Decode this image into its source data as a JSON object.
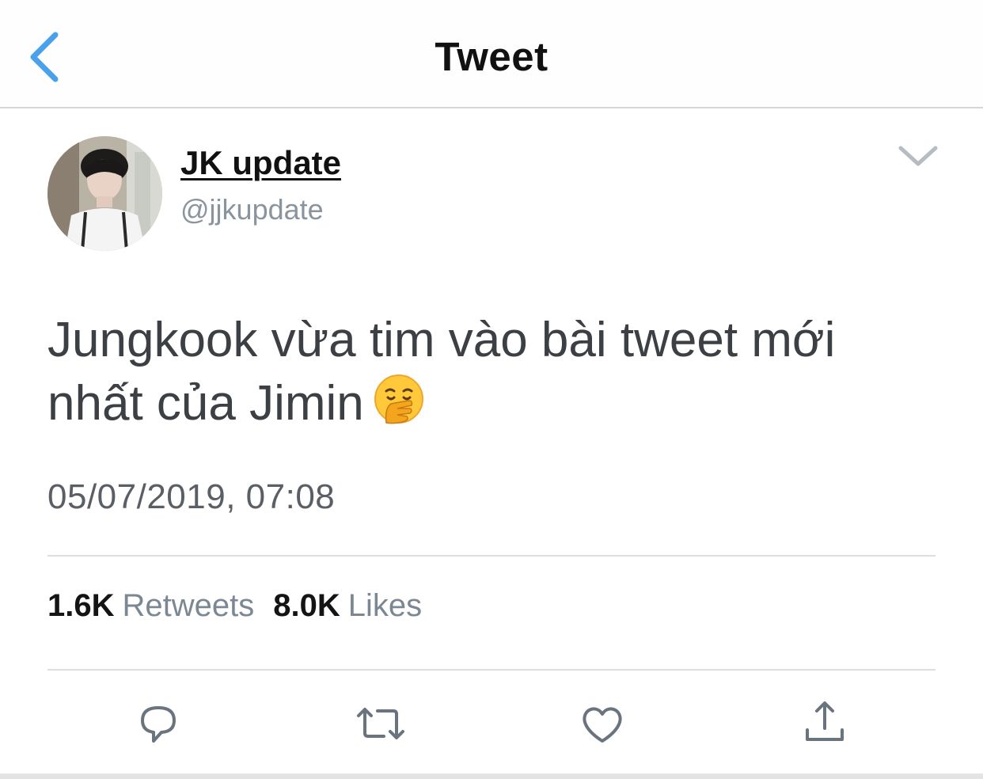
{
  "nav": {
    "title": "Tweet",
    "back_icon": "chevron-left-icon"
  },
  "author": {
    "display_name": "JK update",
    "handle": "@jjkupdate",
    "menu_icon": "chevron-down-icon"
  },
  "tweet": {
    "text": "Jungkook vừa tim vào bài tweet mới nhất của Jimin",
    "emoji": "face-with-hand-over-mouth",
    "timestamp": "05/07/2019, 07:08"
  },
  "stats": {
    "retweets_count": "1.6K",
    "retweets_label": "Retweets",
    "likes_count": "8.0K",
    "likes_label": "Likes"
  },
  "actions": [
    "reply-icon",
    "retweet-icon",
    "like-icon",
    "share-icon"
  ],
  "colors": {
    "accent": "#4aa1eb",
    "text_primary": "#111111",
    "text_secondary": "#8a949e",
    "icon_gray": "#69747f",
    "divider": "#dcdfe2"
  }
}
